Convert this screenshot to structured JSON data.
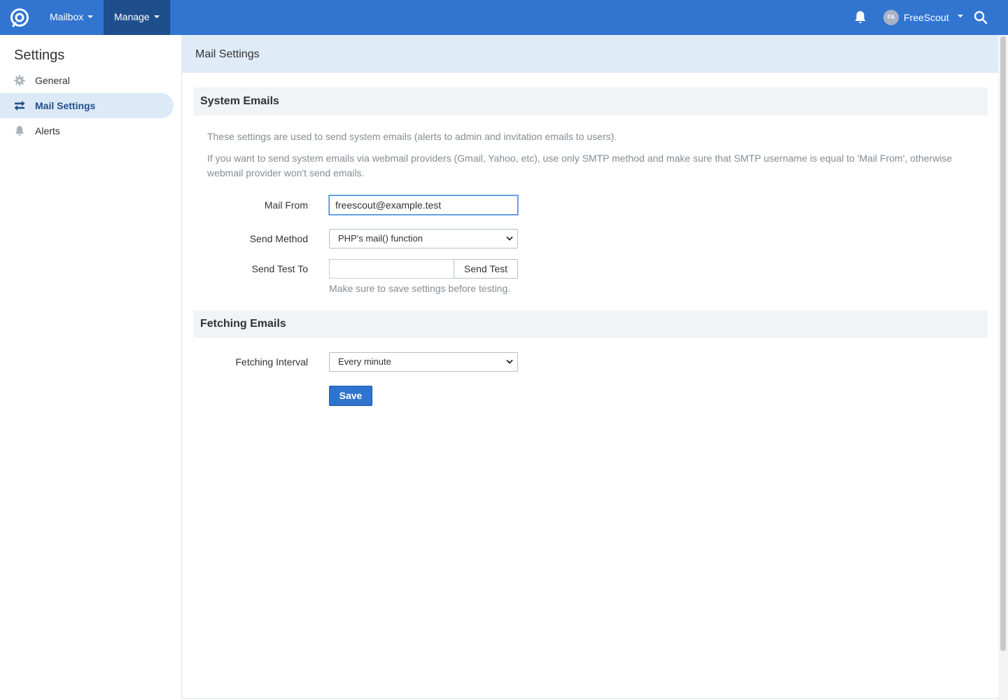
{
  "navbar": {
    "logo_icon": "freescout-logo-icon",
    "mailbox_label": "Mailbox",
    "manage_label": "Manage",
    "notifications_icon": "bell-icon",
    "user": {
      "initials": "FA",
      "name": "FreeScout"
    },
    "search_icon": "search-icon",
    "colors": {
      "bar": "#3175d1",
      "active": "#1f4e8c"
    }
  },
  "sidebar": {
    "title": "Settings",
    "items": [
      {
        "label": "General",
        "icon": "gear-icon",
        "active": false
      },
      {
        "label": "Mail Settings",
        "icon": "exchange-arrows-icon",
        "active": true
      },
      {
        "label": "Alerts",
        "icon": "bell-icon",
        "active": false
      }
    ]
  },
  "main": {
    "title": "Mail Settings",
    "system_emails": {
      "heading": "System Emails",
      "description_1": "These settings are used to send system emails (alerts to admin and invitation emails to users).",
      "description_2": "If you want to send system emails via webmail providers (Gmail, Yahoo, etc), use only SMTP method and make sure that SMTP username is equal to 'Mail From', otherwise webmail provider won't send emails.",
      "mail_from": {
        "label": "Mail From",
        "value": "freescout@example.test"
      },
      "send_method": {
        "label": "Send Method",
        "selected": "PHP's mail() function"
      },
      "send_test": {
        "label": "Send Test To",
        "value": "",
        "button": "Send Test",
        "help": "Make sure to save settings before testing."
      }
    },
    "fetching_emails": {
      "heading": "Fetching Emails",
      "interval": {
        "label": "Fetching Interval",
        "selected": "Every minute"
      }
    },
    "save_button": "Save"
  }
}
